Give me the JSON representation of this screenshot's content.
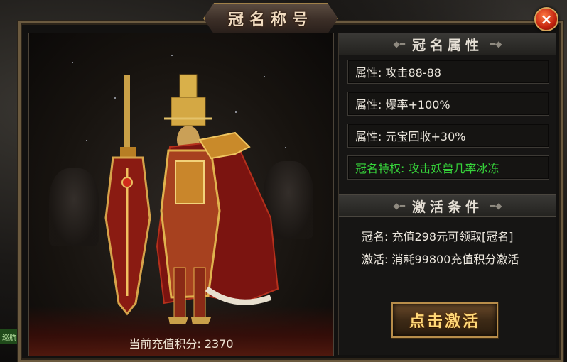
{
  "window": {
    "title": "冠名称号",
    "close_icon": "close-icon"
  },
  "side_tag": "巡航",
  "preview": {
    "points_label": "当前充值积分: 2370"
  },
  "attributes_section": {
    "title": "冠名属性",
    "items": [
      {
        "text": "属性: 攻击88-88",
        "color": "#ebe6dd"
      },
      {
        "text": "属性: 爆率+100%",
        "color": "#ebe6dd"
      },
      {
        "text": "属性: 元宝回收+30%",
        "color": "#ebe6dd"
      },
      {
        "text": "冠名特权: 攻击妖兽几率冰冻",
        "color": "#36d33a"
      }
    ]
  },
  "conditions_section": {
    "title": "激活条件",
    "lines": [
      "冠名: 充值298元可领取[冠名]",
      "激活: 消耗99800充值积分激活"
    ]
  },
  "activate_button": {
    "label": "点击激活"
  }
}
